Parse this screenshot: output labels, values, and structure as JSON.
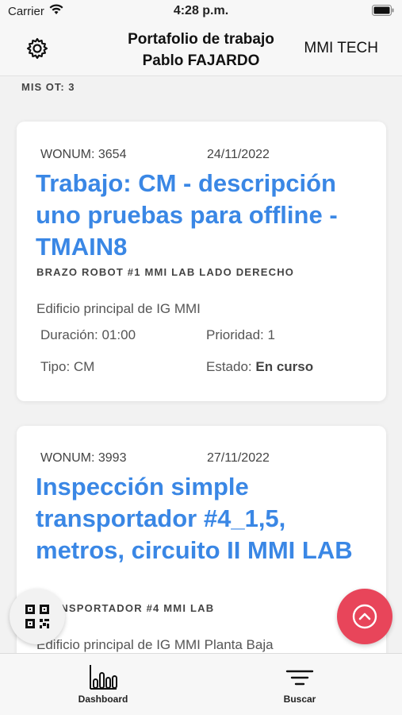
{
  "status_bar": {
    "carrier": "Carrier",
    "time": "4:28 p.m."
  },
  "header": {
    "title_line1": "Portafolio de trabajo",
    "title_line2": "Pablo FAJARDO",
    "right_label": "MMI TECH",
    "settings_icon": "gear-icon"
  },
  "list": {
    "count_label": "MIS OT: 3",
    "cards": [
      {
        "wonum": "WONUM: 3654",
        "date": "24/11/2022",
        "title": "Trabajo: CM - descripción uno pruebas para offline - TMAIN8",
        "asset": "BRAZO ROBOT #1 MMI LAB LADO DERECHO",
        "location": "Edificio principal de IG MMI",
        "duration": "Duración: 01:00",
        "priority": "Prioridad: 1",
        "type": "Tipo: CM",
        "status_label": "Estado:",
        "status_value": "En curso"
      },
      {
        "wonum": "WONUM: 3993",
        "date": "27/11/2022",
        "title": "Inspección simple transportador #4_1,5, metros, circuito II MMI LAB",
        "asset": "TRANSPORTADOR #4 MMI LAB",
        "location": "Edificio principal de IG MMI Planta Baja"
      }
    ]
  },
  "fab": {
    "qr_icon": "qr-code-icon",
    "up_icon": "chevron-up-circle-icon",
    "up_color": "#e8455a"
  },
  "tabbar": {
    "items": [
      {
        "label": "Dashboard",
        "icon": "bar-chart-icon"
      },
      {
        "label": "Buscar",
        "icon": "filter-icon"
      }
    ]
  },
  "colors": {
    "accent": "#3a87e5"
  }
}
